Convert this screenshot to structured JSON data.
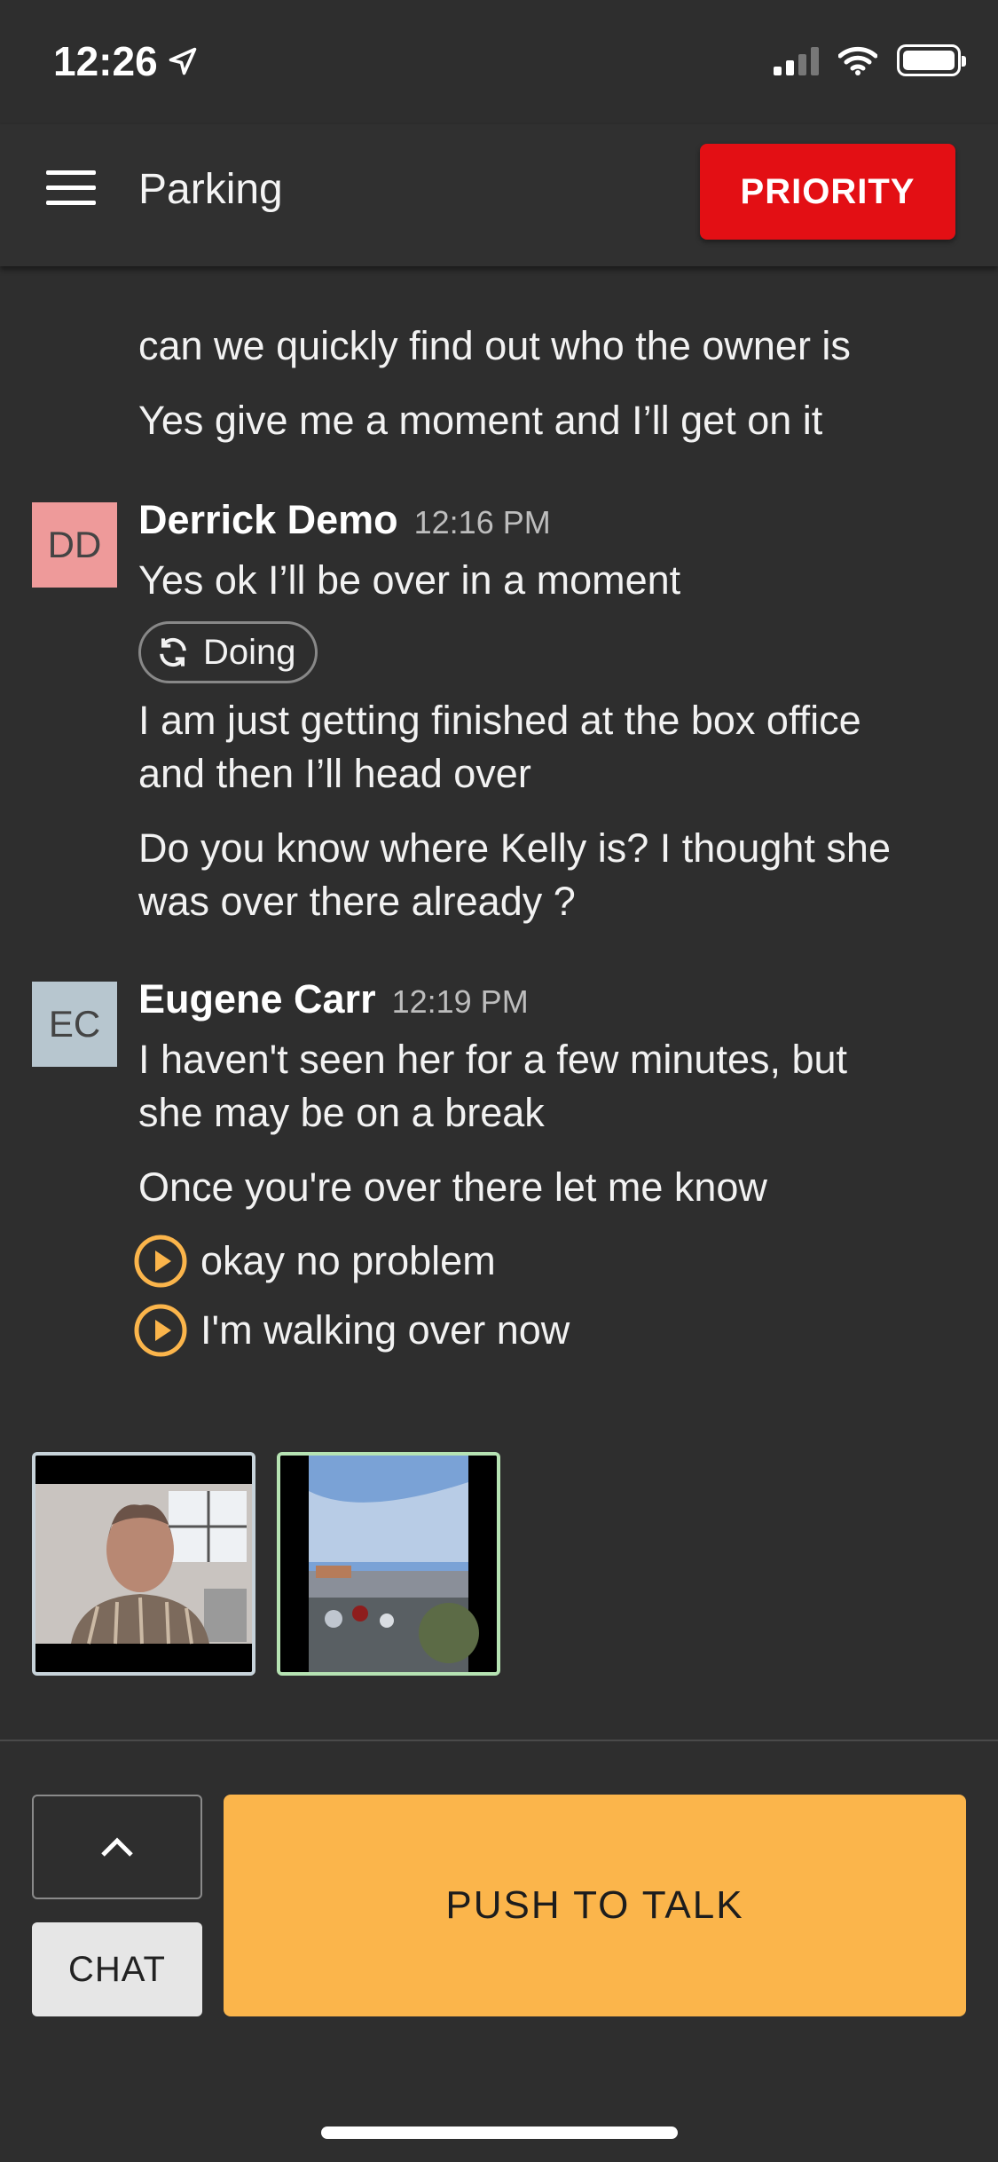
{
  "status_bar": {
    "time": "12:26"
  },
  "header": {
    "title": "Parking",
    "priority_label": "PRIORITY"
  },
  "messages": {
    "prev_1": "can we quickly find out who the owner is",
    "prev_2": "Yes give me a moment and I’ll get on it",
    "derrick": {
      "initials": "DD",
      "name": "Derrick Demo",
      "time": "12:16 PM",
      "avatar_color": "#ee9a9a",
      "lines": [
        "Yes ok I’ll be over in a moment",
        "I am just getting finished at the box office",
        "and then I’ll head over",
        "Do you know where Kelly is? I thought she",
        "was over there already ?"
      ],
      "status_pill": "Doing"
    },
    "eugene": {
      "initials": "EC",
      "name": "Eugene Carr",
      "time": "12:19 PM",
      "avatar_color": "#b7c6cf",
      "lines": [
        "I haven't seen her for a few minutes, but",
        "she may be on a break",
        "Once you're over there let me know"
      ],
      "audio": [
        {
          "label": "okay no problem"
        },
        {
          "label": "I'm walking over now"
        }
      ]
    }
  },
  "controls": {
    "chat_label": "CHAT",
    "ptt_label": "PUSH TO TALK"
  },
  "colors": {
    "accent": "#fbb54b",
    "priority": "#e30f14",
    "background": "#2e2e2e"
  }
}
